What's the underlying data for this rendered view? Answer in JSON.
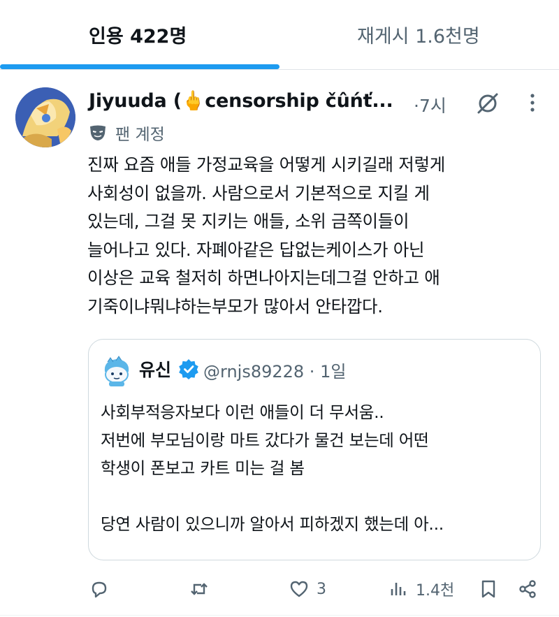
{
  "tabs": {
    "quotes": "인용 422명",
    "reposts": "재게시 1.6천명"
  },
  "post": {
    "author_name": "Jiyuuda (🖕censorship čûńť...",
    "time": "·7시",
    "fan_badge_label": "팬 계정",
    "body_lines": [
      "진짜 요즘 애들 가정교육을 어떻게 시키길래 저렇게",
      "사회성이 없을까. 사람으로서 기본적으로 지킬 게",
      "있는데, 그걸 못 지키는 애들, 소위 금쪽이들이",
      "늘어나고 있다. 자폐아같은 답없는케이스가 아닌",
      "이상은 교육 철저히 하면나아지는데그걸 안하고 애",
      "기죽이냐뭐냐하는부모가 많아서 안타깝다."
    ]
  },
  "quote": {
    "name": "유신",
    "handle_time": "@rnjs89228 · 1일",
    "body_lines": [
      "사회부적응자보다 이런 애들이 더 무서움..",
      "저번에 부모님이랑 마트 갔다가 물건 보는데 어떤",
      "학생이 폰보고 카트 미는 걸 봄",
      "",
      "당연 사람이 있으니까 알아서 피하겠지 했는데 아..."
    ]
  },
  "actions": {
    "reply_icon": "reply-icon",
    "repost_icon": "repost-icon",
    "like_icon": "heart-icon",
    "like_count": "3",
    "views_icon": "views-icon",
    "views_count": "1.4천",
    "bookmark_icon": "bookmark-icon",
    "share_icon": "share-icon"
  },
  "colors": {
    "accent": "#1d9bf0",
    "secondary_text": "#536471",
    "primary_text": "#0f1419",
    "border": "#cfd9de"
  }
}
